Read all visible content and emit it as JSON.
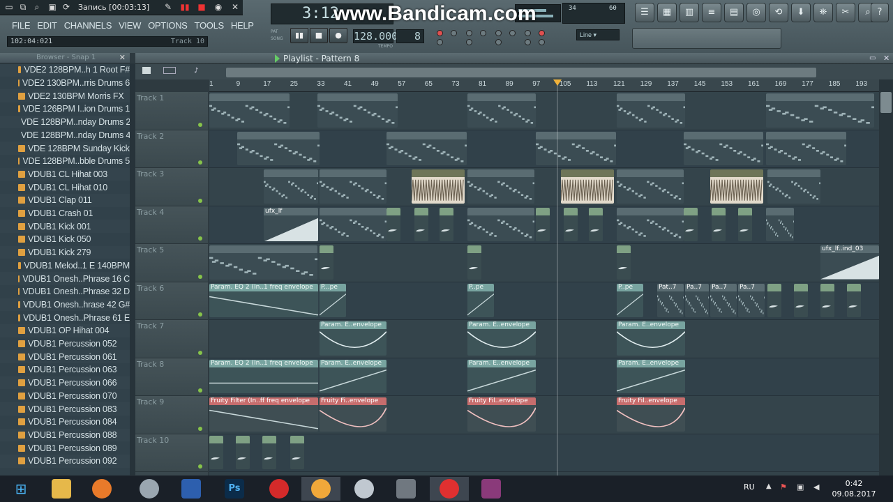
{
  "recorder": {
    "title": "Запись [00:03:13]"
  },
  "watermark": "www.Bandicam.com",
  "menu": [
    "FILE",
    "EDIT",
    "CHANNELS",
    "VIEW",
    "OPTIONS",
    "TOOLS",
    "HELP"
  ],
  "hint": {
    "time": "102:04:021",
    "target": "Track 10"
  },
  "transport": {
    "time": "3:12",
    "tempo": "128.000",
    "step": "8",
    "tempo_label": "TEMPO",
    "pat_label": "PAT",
    "song_label": "SONG"
  },
  "cpu": {
    "poly": "60",
    "mem": "34"
  },
  "line_mode": "Line",
  "browser": {
    "title": "Browser - Snap 1",
    "items": [
      "VDE2 128BPM..h 1 Root F#",
      "VDE2 130BPM..rris Drums 6",
      "VDE2 130BPM Morris FX",
      "VDE 126BPM I..ion Drums 1",
      "VDE 128BPM..nday Drums 2",
      "VDE 128BPM..nday Drums 4",
      "VDE 128BPM Sunday Kick",
      "VDE 128BPM..bble Drums 5",
      "VDUB1 CL Hihat 003",
      "VDUB1 CL Hihat 010",
      "VDUB1 Clap 011",
      "VDUB1 Crash 01",
      "VDUB1 Kick 001",
      "VDUB1 Kick 050",
      "VDUB1 Kick 279",
      "VDUB1 Melod..1 E 140BPM",
      "VDUB1 Onesh..Phrase 16 C",
      "VDUB1 Onesh..Phrase 32 D",
      "VDUB1 Onesh..hrase 42 G#",
      "VDUB1 Onesh..Phrase 61 E",
      "VDUB1 OP Hihat 004",
      "VDUB1 Percussion 052",
      "VDUB1 Percussion 061",
      "VDUB1 Percussion 063",
      "VDUB1 Percussion 066",
      "VDUB1 Percussion 070",
      "VDUB1 Percussion 083",
      "VDUB1 Percussion 084",
      "VDUB1 Percussion 088",
      "VDUB1 Percussion 089",
      "VDUB1 Percussion 092"
    ]
  },
  "playlist": {
    "title": "Playlist - Pattern 8",
    "ruler": [
      "1",
      "9",
      "17",
      "25",
      "33",
      "41",
      "49",
      "57",
      "65",
      "73",
      "81",
      "89",
      "97",
      "105",
      "113",
      "121",
      "129",
      "137",
      "145",
      "153",
      "161",
      "169",
      "177",
      "185",
      "193"
    ],
    "tracks": [
      "Track 1",
      "Track 2",
      "Track 3",
      "Track 4",
      "Track 5",
      "Track 6",
      "Track 7",
      "Track 8",
      "Track 9",
      "Track 10"
    ],
    "labels": {
      "ufx": "ufx_lf",
      "ufx2": "ufx_lf..ind_03",
      "param_eq": "Param. EQ 2 (In..1 freq envelope",
      "param_short": "P...pe",
      "param_short2": "P..pe",
      "pat7": "Pat..7",
      "pa7": "Pa..7",
      "param_env": "Param. E..envelope",
      "fruity_long": "Fruity Filter (In..ff freq envelope",
      "fruity_mid": "Fruity Fi..envelope",
      "fruity_short": "Fruity Fil..envelope"
    }
  },
  "taskbar": {
    "lang": "RU",
    "time": "0:42",
    "date": "09.08.2017"
  }
}
